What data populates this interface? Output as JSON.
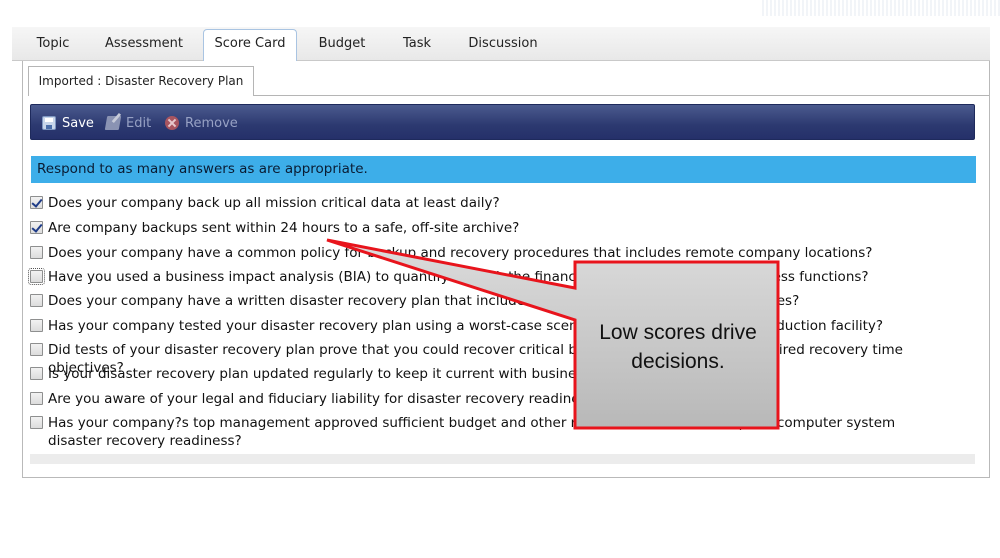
{
  "tabs": [
    "Topic",
    "Assessment",
    "Score Card",
    "Budget",
    "Task",
    "Discussion"
  ],
  "active_tab": "Score Card",
  "subtab": {
    "label": "Imported : Disaster Recovery Plan"
  },
  "toolbar": {
    "save_label": "Save",
    "edit_label": "Edit",
    "remove_label": "Remove"
  },
  "hint": "Respond to as many answers as are appropriate.",
  "questions": [
    {
      "text": "Does your company back up all mission critical data at least daily?",
      "checked": true
    },
    {
      "text": "Are company backups sent within 24 hours to a safe, off-site archive?",
      "checked": true
    },
    {
      "text": "Does your company have a common policy for backup and recovery procedures that includes remote company locations?",
      "checked": false
    },
    {
      "text": "Have you used a business impact analysis (BIA) to quantify the risk the financial impact of losing key business functions?",
      "checked": false
    },
    {
      "text": "Does your company have a written disaster recovery plan that includes all mission critical business processes?",
      "checked": false
    },
    {
      "text": "Has your company tested your disaster recovery plan using a worst-case scenario, such as the loss of a production facility?",
      "checked": false
    },
    {
      "text": "Did tests of your disaster recovery plan prove that you could recover critical business processes within required recovery time objectives?",
      "checked": false
    },
    {
      "text": "Is your disaster recovery plan updated regularly to keep it current with business requirements?",
      "checked": false
    },
    {
      "text": "Are you aware of your legal and fiduciary liability for disaster recovery readiness?",
      "checked": false
    },
    {
      "text": "Has your company?s top management approved sufficient budget and other resources to ensure adequate computer system disaster recovery readiness?",
      "checked": false
    }
  ],
  "callout": {
    "line1": "Low scores drive",
    "line2": "decisions."
  },
  "colors": {
    "toolbar": "#2c3970",
    "hint_bar": "#3daee9",
    "callout_border": "#e8141c",
    "callout_fill": "#c8c8c8"
  }
}
